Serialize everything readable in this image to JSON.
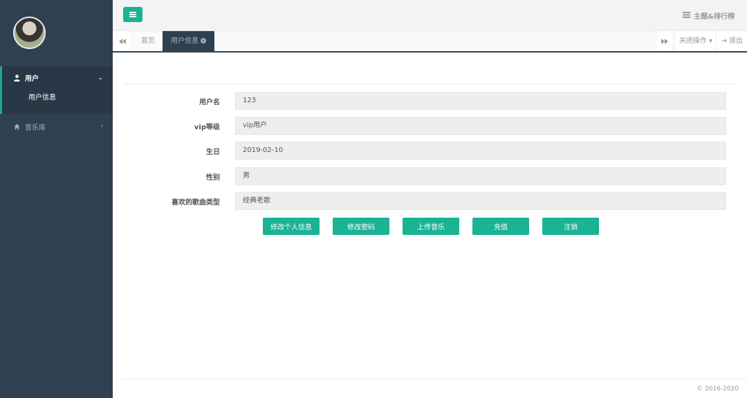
{
  "sidebar": {
    "menu": [
      {
        "label": "用户",
        "icon": "user-icon",
        "arrow": "⌄"
      },
      {
        "label": "音乐库",
        "icon": "home-icon",
        "arrow": "‹"
      }
    ],
    "submenu": {
      "label": "用户信息"
    }
  },
  "topbar": {
    "theme_label": "主题&排行榜"
  },
  "tabs": {
    "home": "首页",
    "active": "用户信息",
    "close_ops": "关闭操作",
    "logout": "退出"
  },
  "form": {
    "fields": [
      {
        "label": "用户名",
        "value": "123"
      },
      {
        "label": "vip等级",
        "value": "vip用户"
      },
      {
        "label": "生日",
        "value": "2019-02-10"
      },
      {
        "label": "性别",
        "value": "男"
      },
      {
        "label": "喜欢的歌曲类型",
        "value": "经典老歌"
      }
    ],
    "buttons": [
      "修改个人信息",
      "修改密码",
      "上传音乐",
      "充值",
      "注销"
    ]
  },
  "footer": {
    "copyright": "© 2016-2020"
  }
}
